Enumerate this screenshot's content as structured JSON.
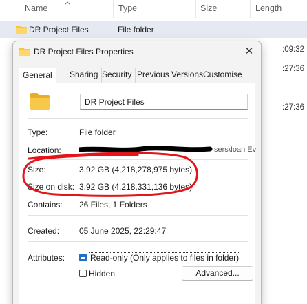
{
  "explorer": {
    "columns": [
      "Name",
      "Type",
      "Size",
      "Length"
    ],
    "row": {
      "name": "DR Project Files",
      "type": "File folder"
    },
    "background_lengths": [
      ":09:32",
      ":27:36",
      ":27:36"
    ]
  },
  "dialog": {
    "title": "DR Project Files Properties",
    "close_glyph": "✕",
    "tabs": [
      "General",
      "Sharing",
      "Security",
      "Previous Versions",
      "Customise"
    ],
    "active_tab": "General",
    "folder_name": "DR Project Files",
    "fields": {
      "type_label": "Type:",
      "type_value": "File folder",
      "location_label": "Location:",
      "location_tail": "sers\\Ioan Ev",
      "size_label": "Size:",
      "size_value": "3.92 GB (4,218,278,975 bytes)",
      "size_on_disk_label": "Size on disk:",
      "size_on_disk_value": "3.92 GB (4,218,331,136 bytes)",
      "contains_label": "Contains:",
      "contains_value": "26 Files, 1 Folders",
      "created_label": "Created:",
      "created_value": "05 June 2025, 22:29:47",
      "attributes_label": "Attributes:",
      "read_only_label": "Read-only (Only applies to files in folder)",
      "hidden_label": "Hidden",
      "advanced_label": "Advanced..."
    }
  },
  "colors": {
    "annotation": "#e3151b",
    "accent": "#1f6fc5",
    "folder": "#f6c343"
  },
  "icons": [
    "folder-icon",
    "close-icon",
    "chevron-up-icon"
  ]
}
